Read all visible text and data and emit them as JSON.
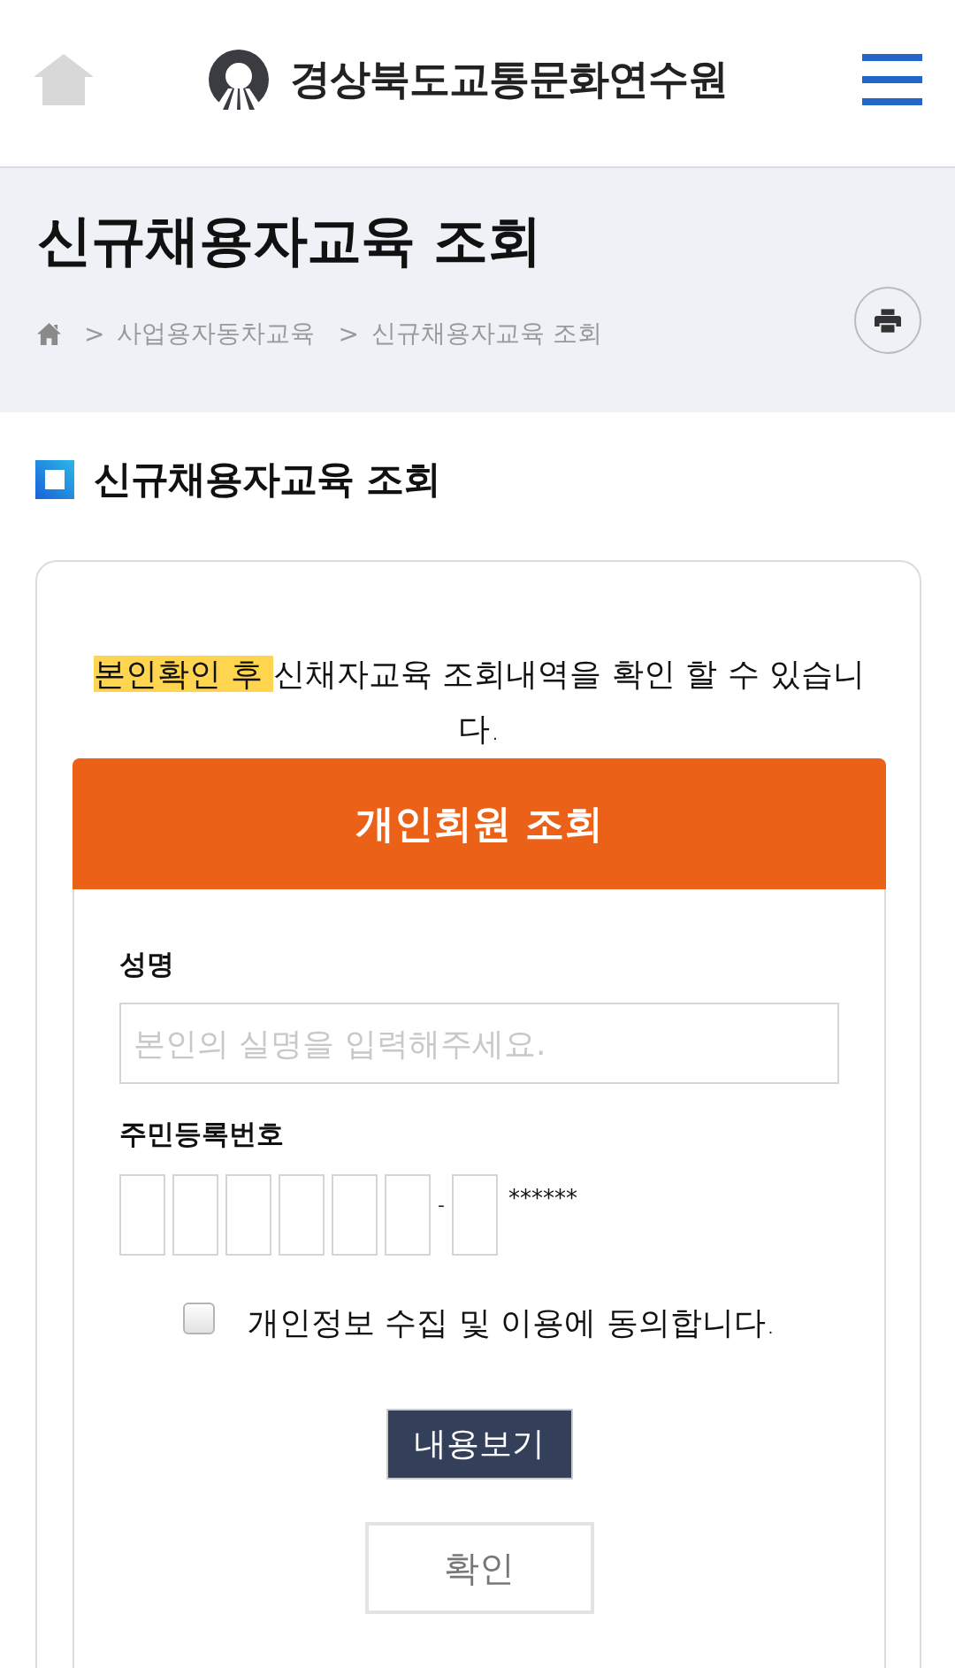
{
  "header": {
    "title": "경상북도교통문화연수원"
  },
  "page_header": {
    "title": "신규채용자교육 조회",
    "breadcrumb": [
      {
        "separator": ">",
        "label": "사업용자동차교육"
      },
      {
        "separator": ">",
        "label": "신규채용자교육 조회"
      }
    ]
  },
  "section": {
    "title": "신규채용자교육 조회"
  },
  "notice": {
    "highlighted": "본인확인 후",
    "text": "신채자교육 조회내역을 확인 할 수 있습니다."
  },
  "lookup_panel": {
    "title": "개인회원 조회",
    "name_field": {
      "label": "성명",
      "placeholder": "본인의 실명을 입력해주세요."
    },
    "id_field": {
      "label": "주민등록번호",
      "parts": [
        {
          "kind": "box"
        },
        {
          "kind": "box"
        },
        {
          "kind": "box"
        },
        {
          "kind": "box"
        },
        {
          "kind": "box"
        },
        {
          "kind": "box"
        },
        {
          "kind": "dash",
          "text": "-"
        },
        {
          "kind": "box"
        },
        {
          "kind": "mask",
          "text": "******"
        }
      ]
    },
    "consent": {
      "checked": false,
      "label": "개인정보 수집 및 이용에 동의합니다."
    },
    "buttons": [
      {
        "kind": "dark",
        "label": "내용보기"
      },
      {
        "kind": "outline",
        "label": "확인"
      }
    ]
  }
}
